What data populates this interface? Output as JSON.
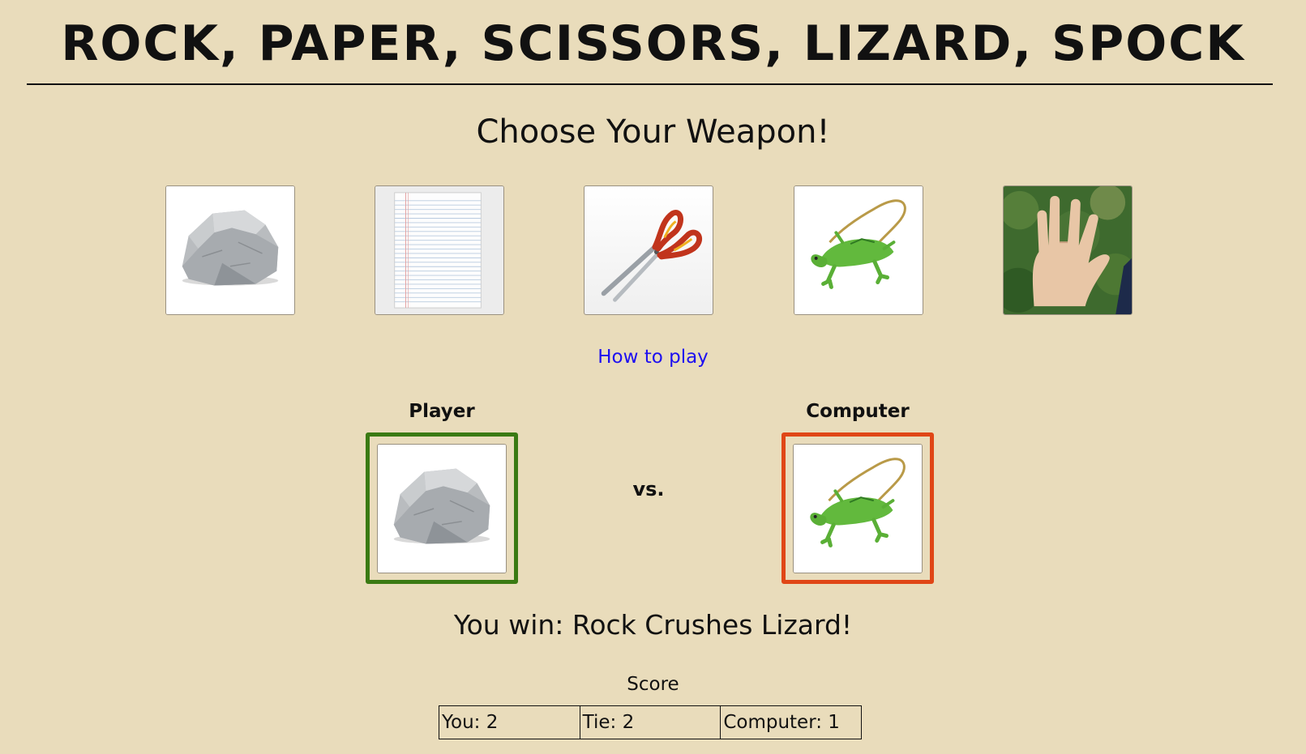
{
  "header": {
    "title": "ROCK, PAPER, SCISSORS, LIZARD, SPOCK"
  },
  "prompt": {
    "text": "Choose Your Weapon!"
  },
  "weapons": [
    {
      "name": "rock",
      "icon": "rock-icon"
    },
    {
      "name": "paper",
      "icon": "paper-icon"
    },
    {
      "name": "scissors",
      "icon": "scissors-icon"
    },
    {
      "name": "lizard",
      "icon": "lizard-icon"
    },
    {
      "name": "spock",
      "icon": "spock-hand-icon"
    }
  ],
  "links": {
    "how_to_play": "How to play"
  },
  "match": {
    "player_label": "Player",
    "computer_label": "Computer",
    "vs_label": "vs.",
    "player_choice": "rock",
    "computer_choice": "lizard",
    "player_border_color": "#3a7a13",
    "computer_border_color": "#e04616"
  },
  "result": {
    "text": "You win: Rock Crushes Lizard!"
  },
  "score": {
    "caption": "Score",
    "you": "You: 2",
    "tie": "Tie: 2",
    "computer": "Computer: 1"
  },
  "colors": {
    "background": "#e9dcbb",
    "link": "#1d0ff0"
  }
}
